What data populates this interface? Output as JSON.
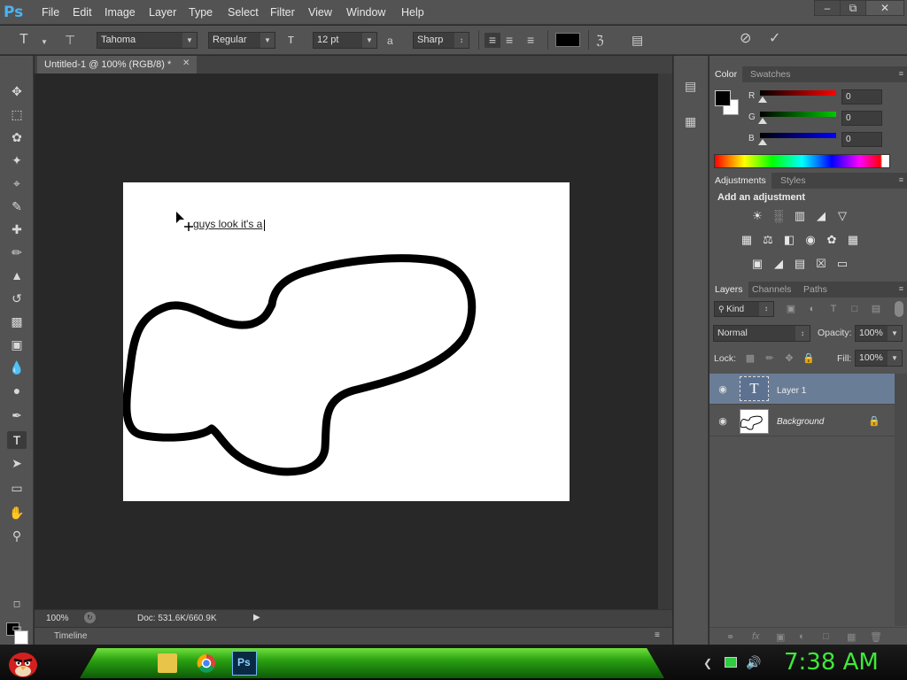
{
  "app": {
    "logo": "Ps",
    "menu": [
      "File",
      "Edit",
      "Image",
      "Layer",
      "Type",
      "Select",
      "Filter",
      "View",
      "Window",
      "Help"
    ]
  },
  "options": {
    "tool_icon": "type-tool-icon",
    "font_family": "Tahoma",
    "font_style": "Regular",
    "font_size": "12 pt",
    "anti_alias": "Sharp",
    "text_color": "#000000"
  },
  "document": {
    "tab_title": "Untitled-1 @ 100% (RGB/8) *",
    "canvas_text": "guys look it's a",
    "zoom": "100%",
    "doc_info": "Doc: 531.6K/660.9K",
    "timeline_label": "Timeline"
  },
  "color_panel": {
    "tabs": [
      "Color",
      "Swatches"
    ],
    "channels": [
      {
        "label": "R",
        "value": "0",
        "color": "#ff0000"
      },
      {
        "label": "G",
        "value": "0",
        "color": "#00c800"
      },
      {
        "label": "B",
        "value": "0",
        "color": "#0000ff"
      }
    ]
  },
  "adjustments_panel": {
    "tabs": [
      "Adjustments",
      "Styles"
    ],
    "heading": "Add an adjustment"
  },
  "layers_panel": {
    "tabs": [
      "Layers",
      "Channels",
      "Paths"
    ],
    "filter": "Kind",
    "blend_mode": "Normal",
    "opacity_label": "Opacity:",
    "opacity": "100%",
    "lock_label": "Lock:",
    "fill_label": "Fill:",
    "fill": "100%",
    "layers": [
      {
        "name": "Layer 1",
        "type": "text",
        "selected": true
      },
      {
        "name": "Background",
        "type": "image",
        "locked": true
      }
    ]
  },
  "taskbar": {
    "clock": "7:38 AM"
  }
}
